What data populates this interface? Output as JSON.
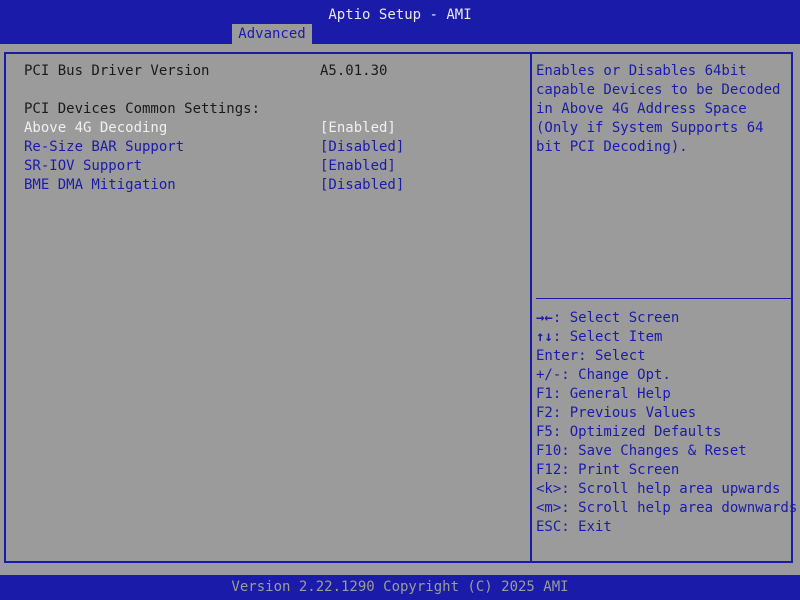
{
  "header": {
    "title": "Aptio Setup - AMI",
    "active_tab": "Advanced"
  },
  "footer": {
    "version": "Version 2.22.1290 Copyright (C) 2025 AMI"
  },
  "settings": {
    "driver_version_label": "PCI Bus Driver Version",
    "driver_version_value": "A5.01.30",
    "section_heading": "PCI Devices Common Settings:",
    "items": [
      {
        "label": "Above 4G Decoding",
        "value": "[Enabled]",
        "selected": true
      },
      {
        "label": "Re-Size BAR Support",
        "value": "[Disabled]",
        "selected": false
      },
      {
        "label": "SR-IOV Support",
        "value": "[Enabled]",
        "selected": false
      },
      {
        "label": "BME DMA Mitigation",
        "value": "[Disabled]",
        "selected": false
      }
    ]
  },
  "help": {
    "lines": [
      "Enables or Disables 64bit",
      "capable Devices to be Decoded",
      "in Above 4G Address Space",
      "(Only if System Supports 64",
      "bit PCI Decoding)."
    ]
  },
  "keys": [
    {
      "icon": "→←",
      "text": ": Select Screen"
    },
    {
      "icon": "↑↓",
      "text": ": Select Item"
    },
    {
      "icon": "",
      "text": "Enter: Select"
    },
    {
      "icon": "",
      "text": "+/-: Change Opt."
    },
    {
      "icon": "",
      "text": "F1: General Help"
    },
    {
      "icon": "",
      "text": "F2: Previous Values"
    },
    {
      "icon": "",
      "text": "F5: Optimized Defaults"
    },
    {
      "icon": "",
      "text": "F10: Save Changes & Reset"
    },
    {
      "icon": "",
      "text": "F12: Print Screen"
    },
    {
      "icon": "",
      "text": "<k>: Scroll help area upwards"
    },
    {
      "icon": "",
      "text": "<m>: Scroll help area downwards"
    },
    {
      "icon": "",
      "text": "ESC: Exit"
    }
  ],
  "colors": {
    "background": "#9b9b9b",
    "bar": "#1b1baa",
    "selected_text": "#f0f0f0",
    "option_text": "#1b1baa",
    "static_text": "#1a1a1a"
  }
}
